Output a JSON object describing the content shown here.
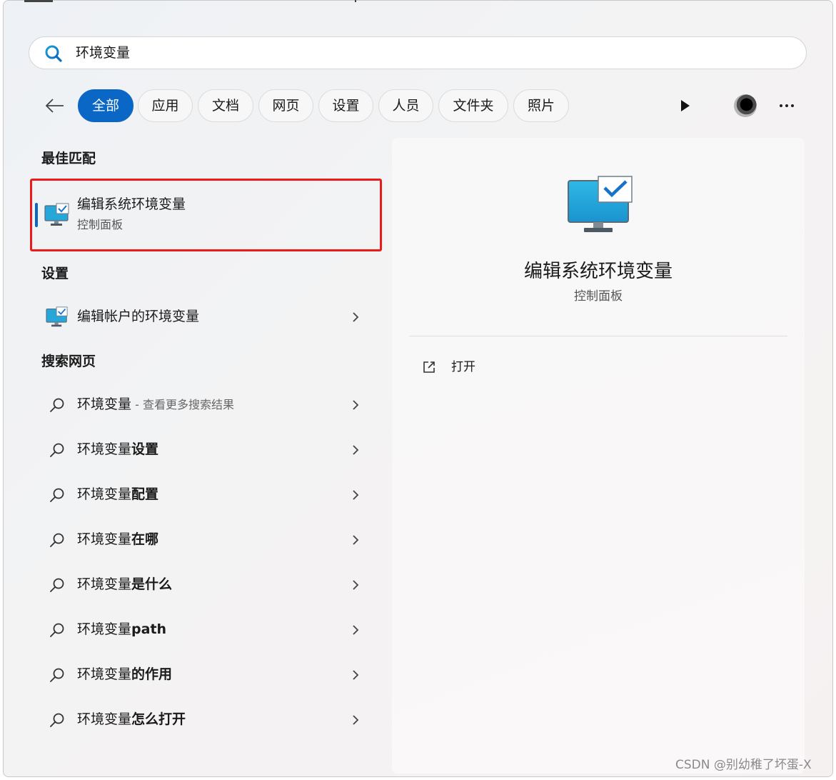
{
  "search": {
    "value": "环境变量"
  },
  "filters": [
    {
      "label": "全部",
      "active": true
    },
    {
      "label": "应用"
    },
    {
      "label": "文档"
    },
    {
      "label": "网页"
    },
    {
      "label": "设置"
    },
    {
      "label": "人员"
    },
    {
      "label": "文件夹"
    },
    {
      "label": "照片"
    }
  ],
  "sections": {
    "best_match": "最佳匹配",
    "settings": "设置",
    "web": "搜索网页"
  },
  "best_match": {
    "name": "编辑系统环境变量",
    "category": "控制面板"
  },
  "settings_items": [
    {
      "label": "编辑帐户的环境变量"
    }
  ],
  "web_items": [
    {
      "prefix": "环境变量",
      "bold": "",
      "suffix": " - 查看更多搜索结果"
    },
    {
      "prefix": "环境变量",
      "bold": "设置",
      "suffix": ""
    },
    {
      "prefix": "环境变量",
      "bold": "配置",
      "suffix": ""
    },
    {
      "prefix": "环境变量",
      "bold": "在哪",
      "suffix": ""
    },
    {
      "prefix": "环境变量",
      "bold": "是什么",
      "suffix": ""
    },
    {
      "prefix": "环境变量",
      "bold": "path",
      "suffix": ""
    },
    {
      "prefix": "环境变量",
      "bold": "的作用",
      "suffix": ""
    },
    {
      "prefix": "环境变量",
      "bold": "怎么打开",
      "suffix": ""
    }
  ],
  "preview": {
    "title": "编辑系统环境变量",
    "subtitle": "控制面板",
    "actions": [
      {
        "label": "打开",
        "icon": "open-external-icon"
      }
    ]
  },
  "watermark": "CSDN @别幼稚了坏蛋-X",
  "colors": {
    "accent": "#0a67c5",
    "highlight_border": "#ea1b1b"
  }
}
